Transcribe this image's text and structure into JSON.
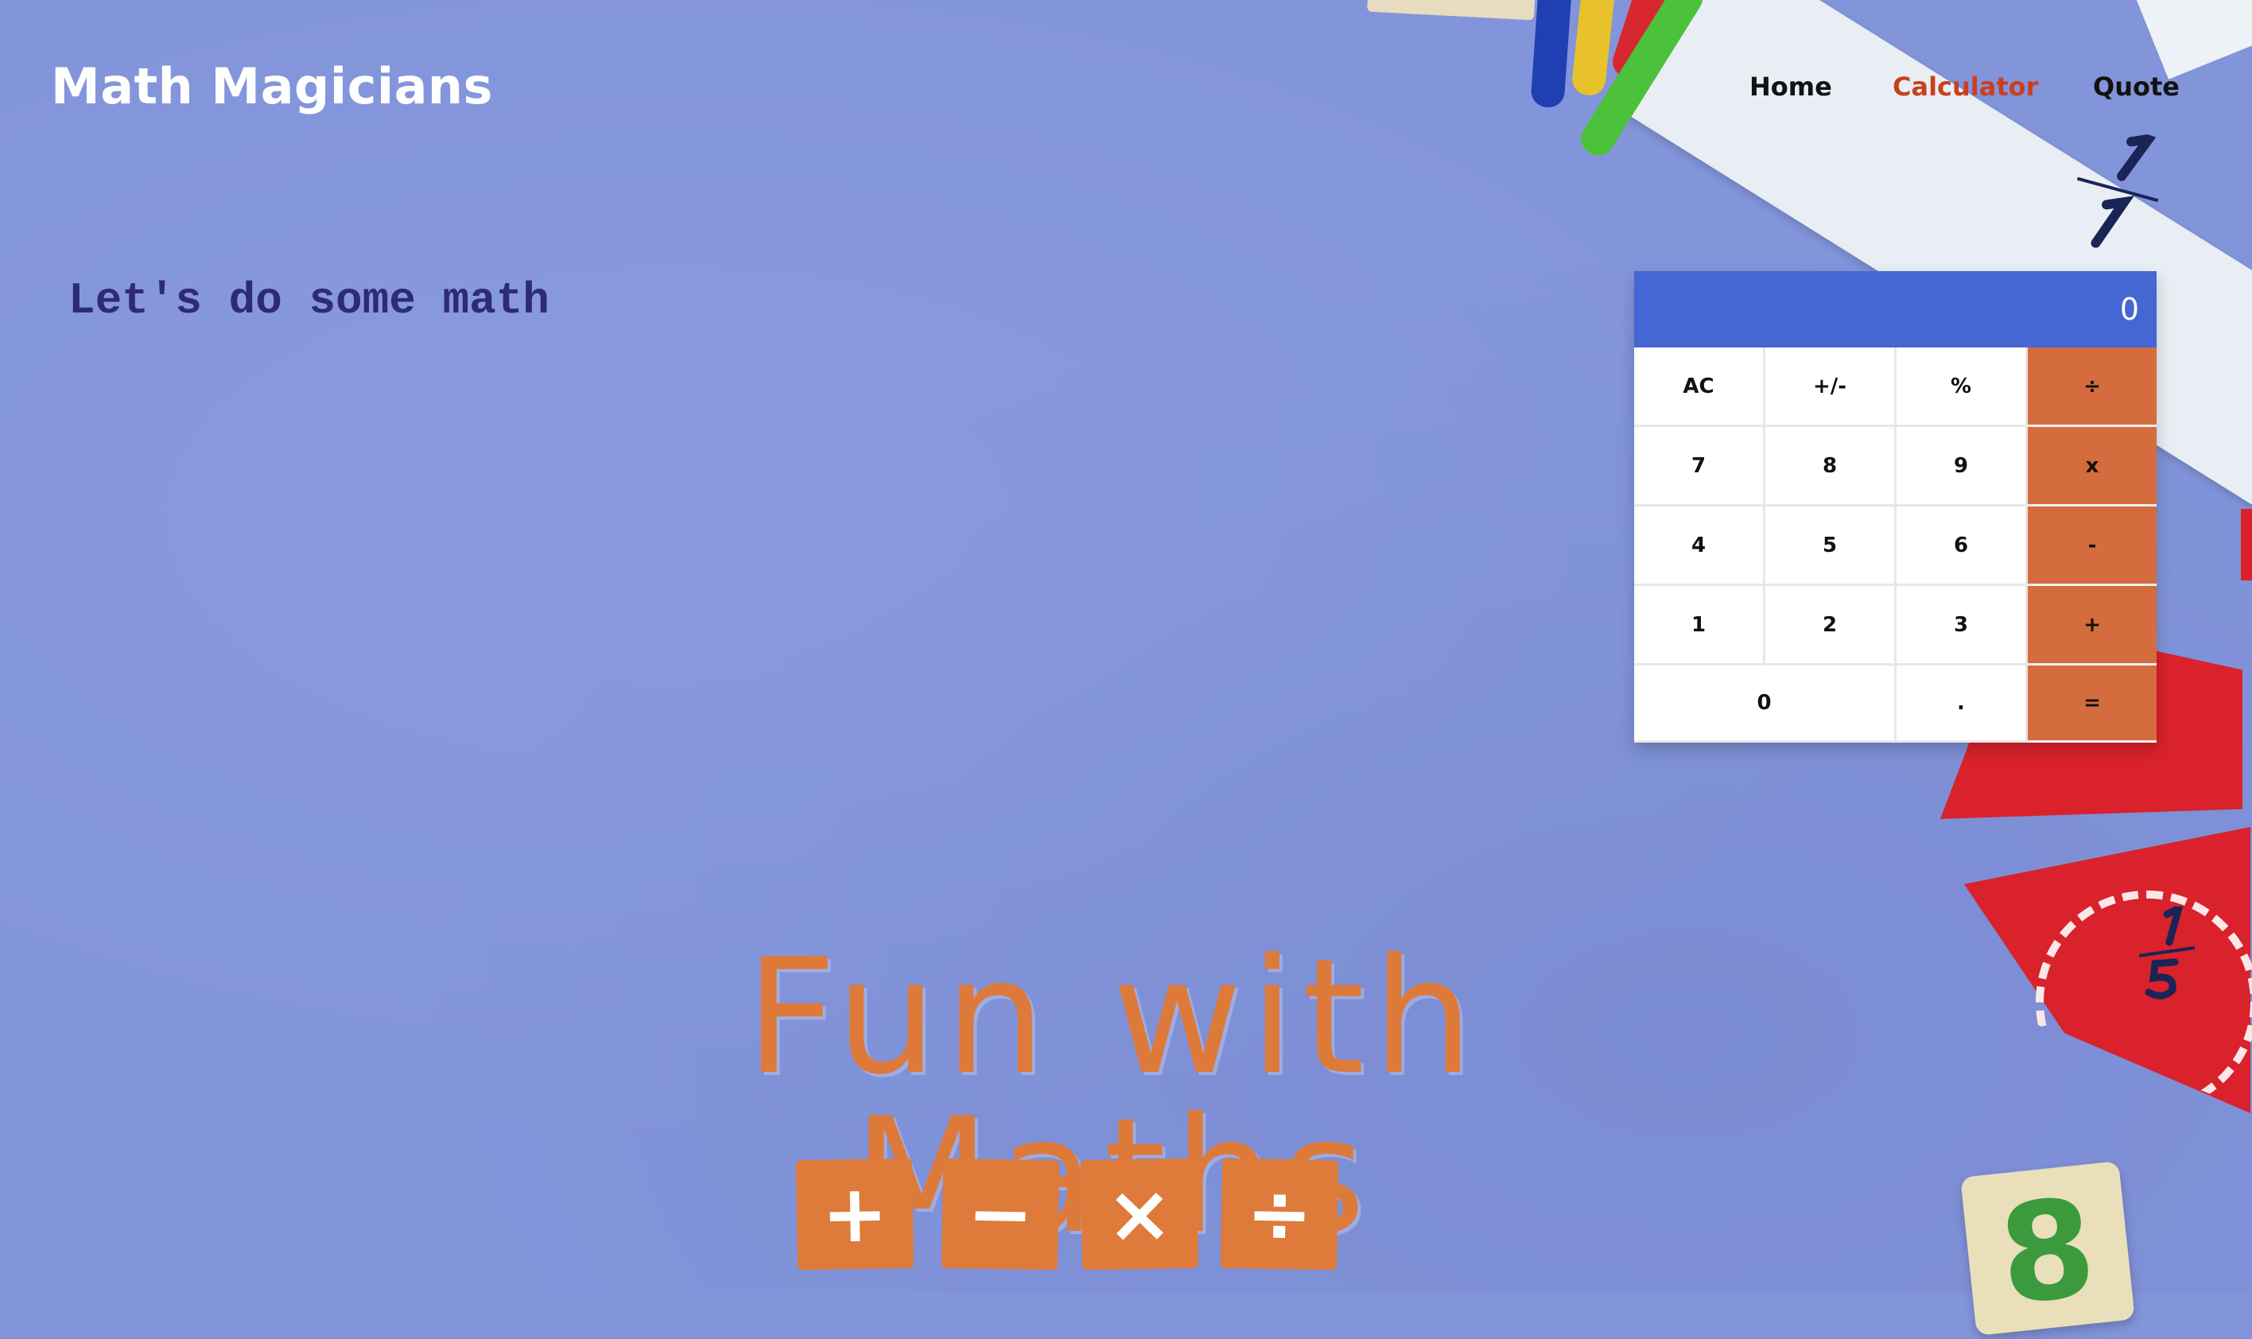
{
  "app": {
    "title": "Math Magicians"
  },
  "nav": {
    "items": [
      {
        "label": "Home",
        "active": false
      },
      {
        "label": "Calculator",
        "active": true
      },
      {
        "label": "Quote",
        "active": false
      }
    ]
  },
  "intro": {
    "heading": "Let's do some math"
  },
  "calculator": {
    "display": "0",
    "keys": {
      "ac": "AC",
      "sign": "+/-",
      "percent": "%",
      "divide": "÷",
      "seven": "7",
      "eight": "8",
      "nine": "9",
      "multiply": "x",
      "four": "4",
      "five": "5",
      "six": "6",
      "subtract": "-",
      "one": "1",
      "two": "2",
      "three": "3",
      "add": "+",
      "zero": "0",
      "decimal": ".",
      "equals": "="
    }
  },
  "banner": {
    "title": "Fun with Maths",
    "operators": [
      "+",
      "−",
      "×",
      "÷"
    ]
  },
  "decor": {
    "tile_number": "8"
  },
  "colors": {
    "background": "#8294da",
    "display": "#4567d4",
    "operator_key": "#d56c3e",
    "nav_active": "#c9401d",
    "heading": "#2e2a78"
  }
}
